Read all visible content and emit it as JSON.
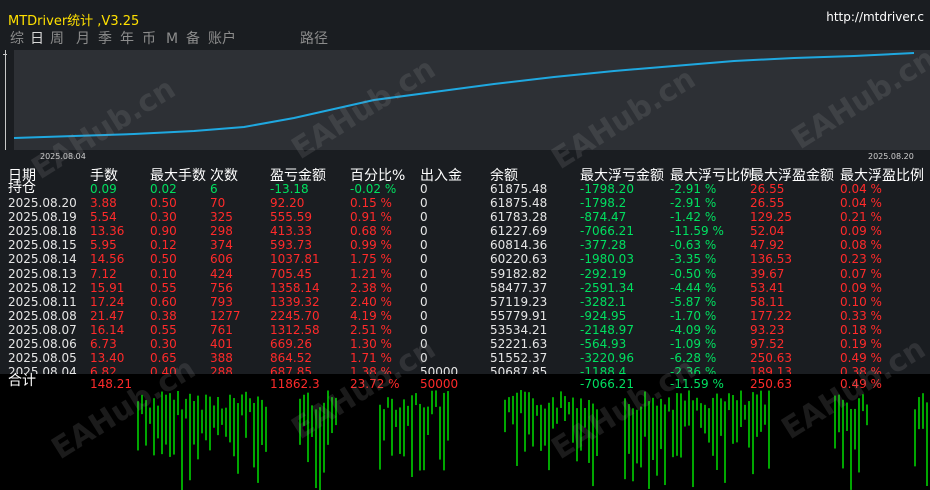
{
  "window": {
    "title": "MTDriver统计 ,V3.25",
    "url": "http://mtdriver.c"
  },
  "tabs": [
    "综",
    "日",
    "周",
    "月",
    "季",
    "年",
    "币",
    "M",
    "备",
    "账户",
    "路径"
  ],
  "active_tab": "日",
  "chart": {
    "start_date": "2025.08.04",
    "end_date": "2025.08.20",
    "line_color": "#1fa8e0"
  },
  "table": {
    "headers": [
      "日期",
      "手数",
      "最大手数",
      "次数",
      "盈亏金额",
      "百分比%",
      "出入金",
      "余额",
      "最大浮亏金额",
      "最大浮亏比例",
      "最大浮盈金额",
      "最大浮盈比例"
    ],
    "holding": {
      "label": "持仓",
      "lots": "0.09",
      "max_lots": "0.02",
      "count": "6",
      "pnl": "-13.18",
      "pct": "-0.02 %",
      "io": "0",
      "balance": "61875.48",
      "max_dd": "-1798.20",
      "max_dd_pct": "-2.91 %",
      "max_fp": "26.55",
      "max_fp_pct": "0.04 %"
    },
    "rows": [
      {
        "date": "2025.08.20",
        "lots": "3.88",
        "max_lots": "0.50",
        "count": "70",
        "pnl": "92.20",
        "pct": "0.15 %",
        "io": "0",
        "balance": "61875.48",
        "max_dd": "-1798.2",
        "max_dd_pct": "-2.91 %",
        "max_fp": "26.55",
        "max_fp_pct": "0.04 %"
      },
      {
        "date": "2025.08.19",
        "lots": "5.54",
        "max_lots": "0.30",
        "count": "325",
        "pnl": "555.59",
        "pct": "0.91 %",
        "io": "0",
        "balance": "61783.28",
        "max_dd": "-874.47",
        "max_dd_pct": "-1.42 %",
        "max_fp": "129.25",
        "max_fp_pct": "0.21 %"
      },
      {
        "date": "2025.08.18",
        "lots": "13.36",
        "max_lots": "0.90",
        "count": "298",
        "pnl": "413.33",
        "pct": "0.68 %",
        "io": "0",
        "balance": "61227.69",
        "max_dd": "-7066.21",
        "max_dd_pct": "-11.59 %",
        "max_fp": "52.04",
        "max_fp_pct": "0.09 %"
      },
      {
        "date": "2025.08.15",
        "lots": "5.95",
        "max_lots": "0.12",
        "count": "374",
        "pnl": "593.73",
        "pct": "0.99 %",
        "io": "0",
        "balance": "60814.36",
        "max_dd": "-377.28",
        "max_dd_pct": "-0.63 %",
        "max_fp": "47.92",
        "max_fp_pct": "0.08 %"
      },
      {
        "date": "2025.08.14",
        "lots": "14.56",
        "max_lots": "0.50",
        "count": "606",
        "pnl": "1037.81",
        "pct": "1.75 %",
        "io": "0",
        "balance": "60220.63",
        "max_dd": "-1980.03",
        "max_dd_pct": "-3.35 %",
        "max_fp": "136.53",
        "max_fp_pct": "0.23 %"
      },
      {
        "date": "2025.08.13",
        "lots": "7.12",
        "max_lots": "0.10",
        "count": "424",
        "pnl": "705.45",
        "pct": "1.21 %",
        "io": "0",
        "balance": "59182.82",
        "max_dd": "-292.19",
        "max_dd_pct": "-0.50 %",
        "max_fp": "39.67",
        "max_fp_pct": "0.07 %"
      },
      {
        "date": "2025.08.12",
        "lots": "15.91",
        "max_lots": "0.55",
        "count": "756",
        "pnl": "1358.14",
        "pct": "2.38 %",
        "io": "0",
        "balance": "58477.37",
        "max_dd": "-2591.34",
        "max_dd_pct": "-4.44 %",
        "max_fp": "53.41",
        "max_fp_pct": "0.09 %"
      },
      {
        "date": "2025.08.11",
        "lots": "17.24",
        "max_lots": "0.60",
        "count": "793",
        "pnl": "1339.32",
        "pct": "2.40 %",
        "io": "0",
        "balance": "57119.23",
        "max_dd": "-3282.1",
        "max_dd_pct": "-5.87 %",
        "max_fp": "58.11",
        "max_fp_pct": "0.10 %"
      },
      {
        "date": "2025.08.08",
        "lots": "21.47",
        "max_lots": "0.38",
        "count": "1277",
        "pnl": "2245.70",
        "pct": "4.19 %",
        "io": "0",
        "balance": "55779.91",
        "max_dd": "-924.95",
        "max_dd_pct": "-1.70 %",
        "max_fp": "177.22",
        "max_fp_pct": "0.33 %"
      },
      {
        "date": "2025.08.07",
        "lots": "16.14",
        "max_lots": "0.55",
        "count": "761",
        "pnl": "1312.58",
        "pct": "2.51 %",
        "io": "0",
        "balance": "53534.21",
        "max_dd": "-2148.97",
        "max_dd_pct": "-4.09 %",
        "max_fp": "93.23",
        "max_fp_pct": "0.18 %"
      },
      {
        "date": "2025.08.06",
        "lots": "6.73",
        "max_lots": "0.30",
        "count": "401",
        "pnl": "669.26",
        "pct": "1.30 %",
        "io": "0",
        "balance": "52221.63",
        "max_dd": "-564.93",
        "max_dd_pct": "-1.09 %",
        "max_fp": "97.52",
        "max_fp_pct": "0.19 %"
      },
      {
        "date": "2025.08.05",
        "lots": "13.40",
        "max_lots": "0.65",
        "count": "388",
        "pnl": "864.52",
        "pct": "1.71 %",
        "io": "0",
        "balance": "51552.37",
        "max_dd": "-3220.96",
        "max_dd_pct": "-6.28 %",
        "max_fp": "250.63",
        "max_fp_pct": "0.49 %"
      },
      {
        "date": "2025.08.04",
        "lots": "6.82",
        "max_lots": "0.40",
        "count": "288",
        "pnl": "687.85",
        "pct": "1.38 %",
        "io": "50000",
        "balance": "50687.85",
        "max_dd": "-1188.4",
        "max_dd_pct": "-2.36 %",
        "max_fp": "189.13",
        "max_fp_pct": "0.38 %"
      }
    ],
    "total": {
      "label": "合计",
      "lots": "148.21",
      "pnl": "11862.3",
      "pct": "23.72 %",
      "io": "50000",
      "max_dd": "-7066.21",
      "max_dd_pct": "-11.59 %",
      "max_fp": "250.63",
      "max_fp_pct": "0.49 %"
    }
  },
  "watermark": "EAHub.cn",
  "colors": {
    "positive": "#ff2a2a",
    "negative": "#00e060",
    "neutral": "#e6e6e6",
    "title": "#ffe000",
    "candles": "#00dd00"
  }
}
